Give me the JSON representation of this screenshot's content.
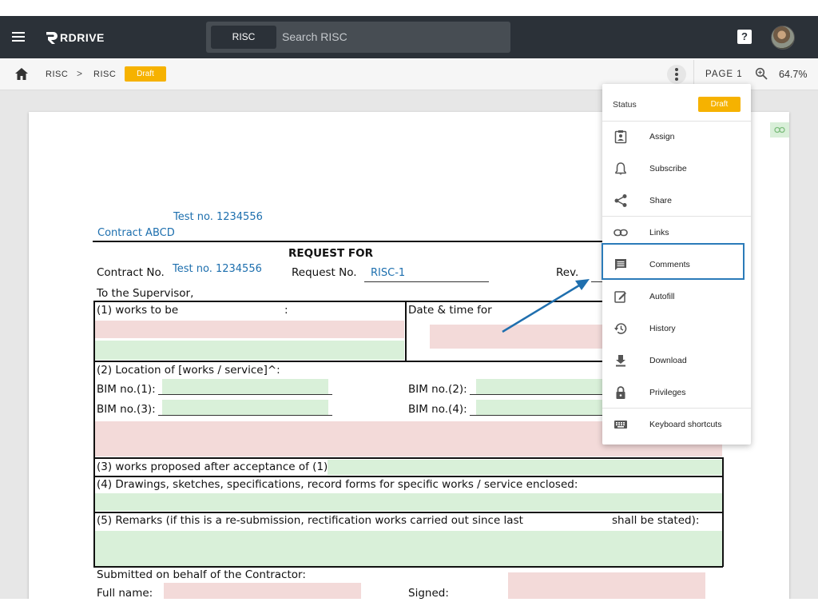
{
  "app": {
    "logo_text": "RDRIVE",
    "search_chip": "RISC",
    "search_placeholder": "Search RISC",
    "help_label": "?"
  },
  "toolbar": {
    "breadcrumbs": [
      "RISC",
      "RISC"
    ],
    "crumb_separator": ">",
    "status_badge": "Draft",
    "page_label": "PAGE 1",
    "zoom_value": "64.7%"
  },
  "menu": {
    "status_label": "Status",
    "status_value": "Draft",
    "items": [
      {
        "label": "Assign",
        "icon": "assign-icon"
      },
      {
        "label": "Subscribe",
        "icon": "bell-icon"
      },
      {
        "label": "Share",
        "icon": "share-icon"
      },
      {
        "label": "Links",
        "icon": "link-icon"
      },
      {
        "label": "Comments",
        "icon": "comment-icon"
      },
      {
        "label": "Autofill",
        "icon": "edit-icon"
      },
      {
        "label": "History",
        "icon": "history-icon"
      },
      {
        "label": "Download",
        "icon": "download-icon"
      },
      {
        "label": "Privileges",
        "icon": "lock-icon"
      },
      {
        "label": "Keyboard shortcuts",
        "icon": "keyboard-icon"
      }
    ]
  },
  "document": {
    "test_no_header": "Test no. 1234556",
    "contract_name": "Contract ABCD",
    "title": "REQUEST FOR",
    "contract_no_label": "Contract No.",
    "contract_no_value": "Test no. 1234556",
    "request_no_label": "Request No.",
    "request_no_value": "RISC-1",
    "rev_label": "Rev.",
    "to_supervisor": "To the Supervisor,",
    "works_to_be": "(1) works to be",
    "colon": ":",
    "date_time_for": "Date & time for",
    "location": "(2) Location of [works / service]^:",
    "bim1": "BIM no.(1):",
    "bim2": "BIM no.(2):",
    "bim3": "BIM no.(3):",
    "bim4": "BIM no.(4):",
    "works_proposed": "(3) works proposed after acceptance of (1):",
    "drawings": "(4) Drawings, sketches, specifications, record forms for specific works / service enclosed:",
    "remarks": "(5) Remarks (if this is a re-submission, rectification works carried out since last",
    "shall_be_stated": "shall be stated):",
    "submitted": "Submitted on behalf of the Contractor:",
    "full_name": "Full name:",
    "signed": "Signed:"
  },
  "colors": {
    "appbar": "#2b3138",
    "accent_yellow": "#f6b200",
    "highlight_blue": "#2b7bb9",
    "field_pink": "#f3dad9",
    "field_green": "#d9f0d9",
    "doc_blue_text": "#1d6fae"
  }
}
